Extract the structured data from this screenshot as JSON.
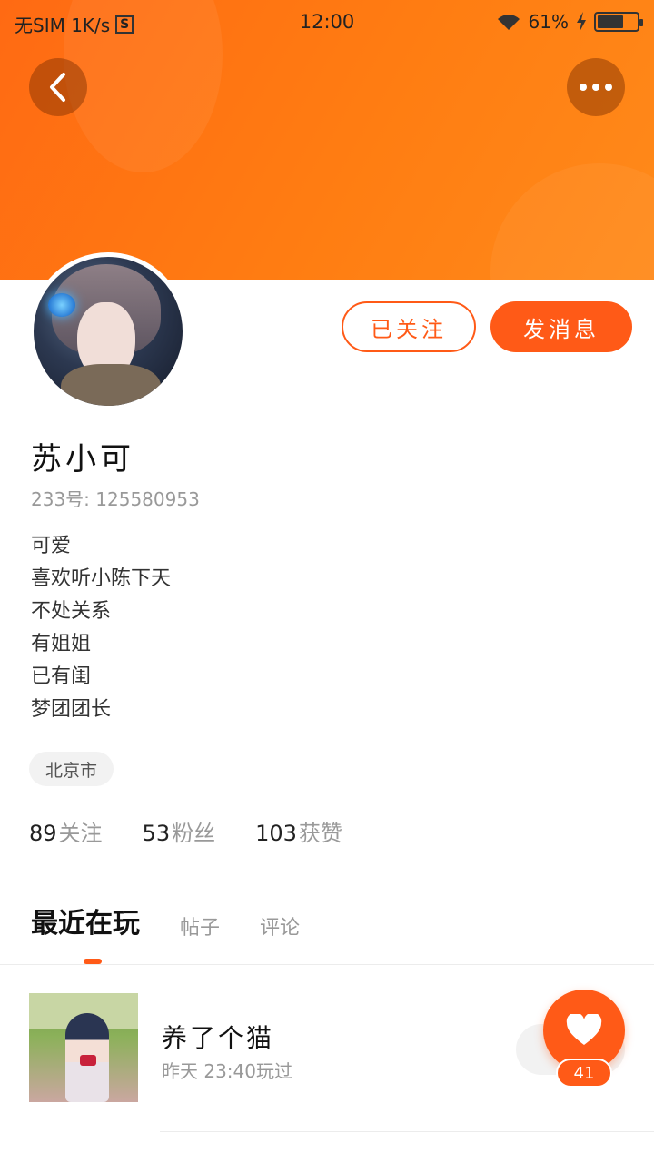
{
  "status_bar": {
    "carrier": "无SIM 1K/s",
    "sim_icon": "S",
    "time": "12:00",
    "battery_text": "61%",
    "icons": [
      "wifi-icon",
      "charging-icon",
      "battery-icon"
    ]
  },
  "header": {
    "back_icon": "chevron-left-icon",
    "more_icon": "more-dots-icon",
    "accent_color": "#ff6a13"
  },
  "profile": {
    "follow_label": "已关注",
    "message_label": "发消息",
    "name": "苏小可",
    "id_text": "233号: 125580953",
    "bio": [
      "可爱",
      "喜欢听小陈下天",
      "不处关系",
      "有姐姐",
      "已有闺",
      "梦团团长"
    ],
    "location": "北京市",
    "stats": [
      {
        "value": "89",
        "label": "关注"
      },
      {
        "value": "53",
        "label": "粉丝"
      },
      {
        "value": "103",
        "label": "获赞"
      }
    ]
  },
  "tabs": [
    {
      "label": "最近在玩",
      "active": true
    },
    {
      "label": "帖子",
      "active": false
    },
    {
      "label": "评论",
      "active": false
    }
  ],
  "recent_games": [
    {
      "title": "养了个猫",
      "time": "昨天 23:40玩过"
    }
  ],
  "like_fab": {
    "icon": "heart-icon",
    "count": "41"
  }
}
